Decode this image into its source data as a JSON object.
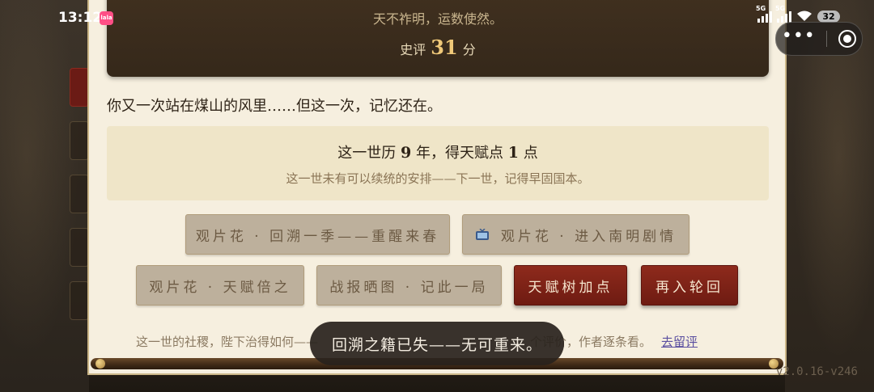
{
  "status_bar": {
    "time": "13:12",
    "app_icon_label": "lala",
    "signal_1": "5G",
    "signal_2": "5G",
    "battery": "32"
  },
  "header": {
    "verdict_line": "天不祚明，运数使然。",
    "score_prefix": "史评",
    "score_value": "31",
    "score_suffix": "分"
  },
  "narration": "你又一次站在煤山的风里……但这一次，记忆还在。",
  "summary": {
    "main_prefix": "这一世历",
    "years": "9",
    "main_middle": "年，得天赋点",
    "points": "1",
    "main_suffix": "点",
    "sub": "这一世未有可以续统的安排——下一世，记得早固国本。"
  },
  "buttons": {
    "rewind_season": "观片花 · 回溯一季——重醒来春",
    "enter_southern_ming": "观片花 · 进入南明剧情",
    "double_talent": "观片花 · 天赋倍之",
    "share_report": "战报晒图 · 记此一局",
    "talent_tree": "天赋树加点",
    "reincarnate": "再入轮回"
  },
  "footer": {
    "text_before": "这一世的社稷，陛下治得如何——",
    "text_after": "个评价，作者逐条看。",
    "link": "去留评"
  },
  "toast": "回溯之籍已失——无可重来。",
  "version": "v2.0.16-v246",
  "colors": {
    "parchment": "#f6efdf",
    "header_bg": "#40301f",
    "accent_red": "#8e2a1c",
    "score_gold": "#f0c979"
  }
}
